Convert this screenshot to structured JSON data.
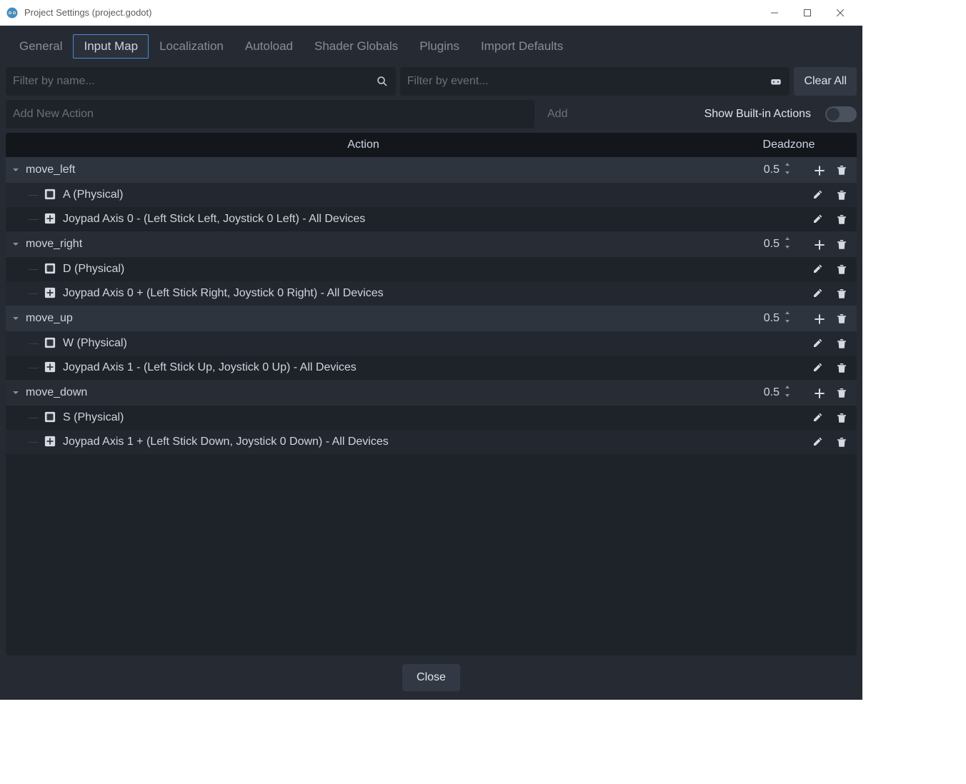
{
  "window": {
    "title": "Project Settings (project.godot)"
  },
  "tabs": [
    {
      "label": "General",
      "active": false
    },
    {
      "label": "Input Map",
      "active": true
    },
    {
      "label": "Localization",
      "active": false
    },
    {
      "label": "Autoload",
      "active": false
    },
    {
      "label": "Shader Globals",
      "active": false
    },
    {
      "label": "Plugins",
      "active": false
    },
    {
      "label": "Import Defaults",
      "active": false
    }
  ],
  "filters": {
    "name_placeholder": "Filter by name...",
    "event_placeholder": "Filter by event...",
    "clear_all": "Clear All"
  },
  "addbar": {
    "placeholder": "Add New Action",
    "add_label": "Add",
    "builtin_label": "Show Built-in Actions"
  },
  "table": {
    "col_action": "Action",
    "col_deadzone": "Deadzone"
  },
  "actions": [
    {
      "name": "move_left",
      "deadzone": "0.5",
      "events": [
        {
          "icon": "key",
          "text": "A (Physical)"
        },
        {
          "icon": "joy",
          "text": "Joypad Axis 0 - (Left Stick Left, Joystick 0 Left) - All Devices"
        }
      ]
    },
    {
      "name": "move_right",
      "deadzone": "0.5",
      "events": [
        {
          "icon": "key",
          "text": "D (Physical)"
        },
        {
          "icon": "joy",
          "text": "Joypad Axis 0 + (Left Stick Right, Joystick 0 Right) - All Devices"
        }
      ]
    },
    {
      "name": "move_up",
      "deadzone": "0.5",
      "events": [
        {
          "icon": "key",
          "text": "W (Physical)"
        },
        {
          "icon": "joy",
          "text": "Joypad Axis 1 - (Left Stick Up, Joystick 0 Up) - All Devices"
        }
      ]
    },
    {
      "name": "move_down",
      "deadzone": "0.5",
      "events": [
        {
          "icon": "key",
          "text": "S (Physical)"
        },
        {
          "icon": "joy",
          "text": "Joypad Axis 1 + (Left Stick Down, Joystick 0 Down) - All Devices"
        }
      ]
    }
  ],
  "footer": {
    "close": "Close"
  }
}
